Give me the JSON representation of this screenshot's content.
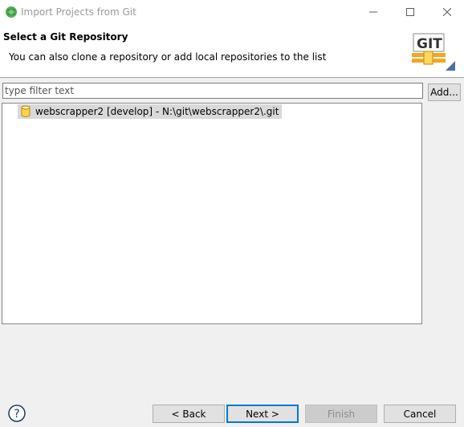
{
  "window": {
    "title": "Import Projects from Git"
  },
  "banner": {
    "title": "Select a Git Repository",
    "description": "You can also clone a repository or add local repositories to the list",
    "logo_text": "GIT"
  },
  "filter": {
    "placeholder": "type filter text",
    "value": ""
  },
  "add_button": "Add...",
  "repositories": [
    {
      "label": "webscrapper2 [develop] - N:\\git\\webscrapper2\\.git",
      "selected": true,
      "icon": "repository-icon"
    }
  ],
  "footer": {
    "back": "< Back",
    "next": "Next >",
    "finish": "Finish",
    "cancel": "Cancel",
    "finish_enabled": false
  },
  "colors": {
    "selection": "#d9d9d9",
    "accent": "#0078d7",
    "title_text": "#9a9a9a"
  }
}
